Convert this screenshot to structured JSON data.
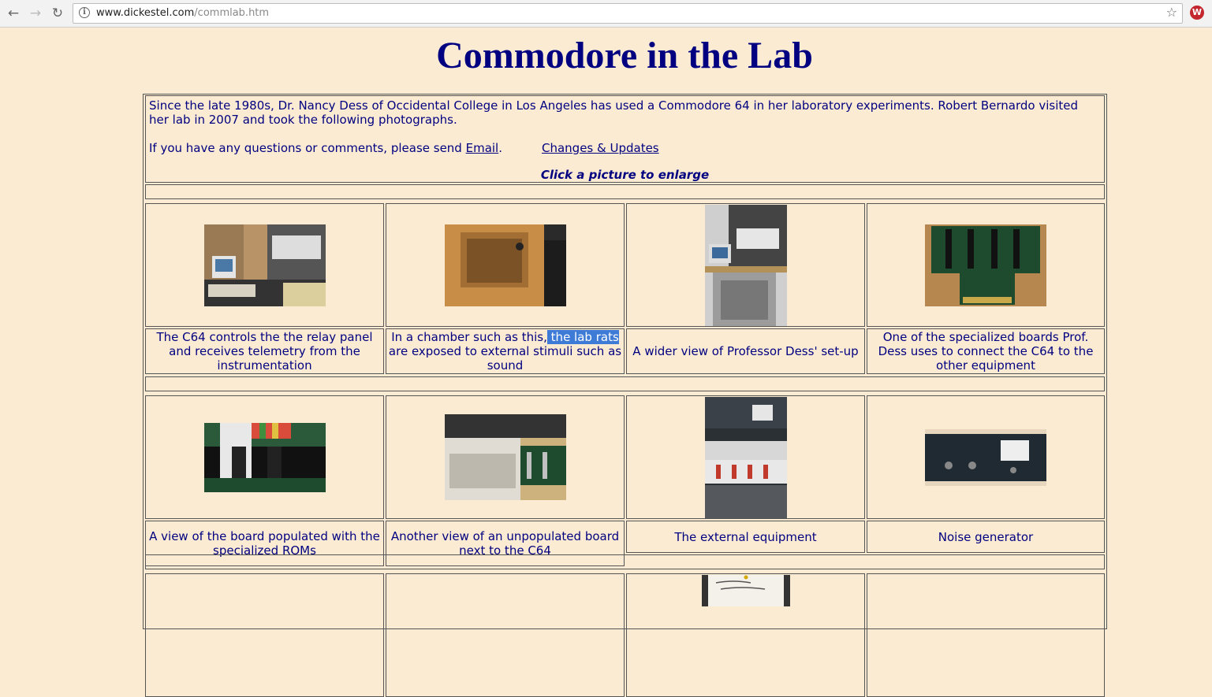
{
  "browser": {
    "url_host": "www.dickestel.com",
    "url_path": "/commlab.htm"
  },
  "page": {
    "title": "Commodore in the Lab",
    "intro_text": "Since the late 1980s, Dr. Nancy Dess of Occidental College in Los Angeles has used a Commodore 64 in her laboratory experiments. Robert Bernardo visited her lab in 2007 and took the following photographs.",
    "contact_prefix": "If you have any questions or comments, please send ",
    "email_link": "Email",
    "contact_suffix": ".",
    "changes_link": "Changes & Updates",
    "click_hint": "Click a picture to enlarge"
  },
  "gallery": {
    "row1": {
      "cap1": "The C64 controls the the relay panel and receives telemetry from the instrumentation",
      "cap2_before": "In a chamber such as this,",
      "cap2_selected": " the lab rats ",
      "cap2_after": "are exposed to external stimuli such as sound",
      "cap3": "A wider view of Professor Dess' set-up",
      "cap4": "One of the specialized boards Prof. Dess uses to connect the C64 to the other equipment"
    },
    "row2": {
      "cap1": "A view of the board populated with the specialized ROMs",
      "cap2": "Another view of an unpopulated board next to the C64",
      "cap3": "The external equipment",
      "cap4": "Noise generator"
    },
    "photo_names": [
      "c64-relay-panel-photo",
      "rat-chamber-photo",
      "lab-setup-wide-photo",
      "specialized-board-photo",
      "populated-board-roms-photo",
      "unpopulated-board-c64-photo",
      "external-equipment-rack-photo",
      "noise-generator-photo",
      "lab-notes-photo"
    ]
  }
}
